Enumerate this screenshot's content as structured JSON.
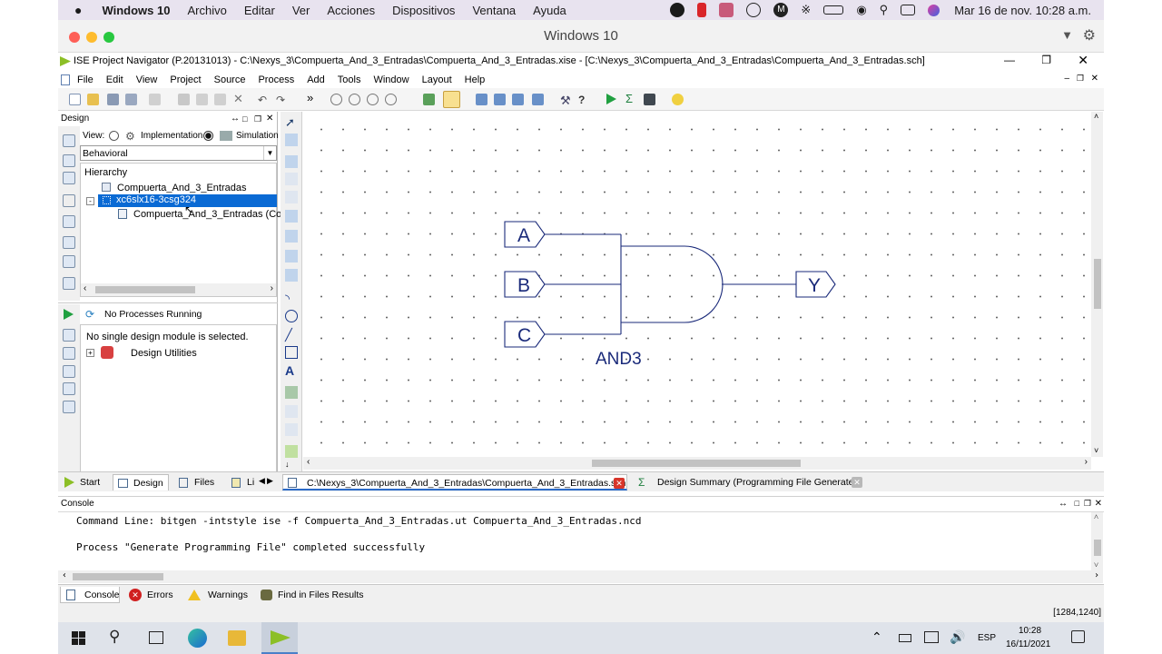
{
  "mac_menubar": {
    "apple": "",
    "app": "Windows 10",
    "items": [
      "Archivo",
      "Editar",
      "Ver",
      "Acciones",
      "Dispositivos",
      "Ventana",
      "Ayuda"
    ],
    "clock": "Mar 16 de nov.  10:28 a.m."
  },
  "vm_window": {
    "title": "Windows 10"
  },
  "ise": {
    "title": "ISE Project Navigator (P.20131013) - C:\\Nexys_3\\Compuerta_And_3_Entradas\\Compuerta_And_3_Entradas.xise - [C:\\Nexys_3\\Compuerta_And_3_Entradas\\Compuerta_And_3_Entradas.sch]",
    "menu": [
      "File",
      "Edit",
      "View",
      "Project",
      "Source",
      "Process",
      "Add",
      "Tools",
      "Window",
      "Layout",
      "Help"
    ],
    "toolbar_more": "»"
  },
  "design_panel": {
    "header": "Design",
    "view_label": "View:",
    "radio_impl": "Implementation",
    "radio_sim": "Simulation",
    "dropdown_value": "Behavioral",
    "hierarchy_label": "Hierarchy",
    "tree": {
      "project": "Compuerta_And_3_Entradas",
      "device": "xc6slx16-3csg324",
      "module": "Compuerta_And_3_Entradas (Cor"
    }
  },
  "processes_panel": {
    "status": "No Processes Running",
    "message": "No single design module is selected.",
    "utilities": "Design Utilities"
  },
  "schematic": {
    "inputs": [
      "A",
      "B",
      "C"
    ],
    "output": "Y",
    "gate_label": "AND3"
  },
  "bottom_tabs": {
    "left": [
      "Start",
      "Design",
      "Files",
      "Li"
    ],
    "doc_tab": "C:\\Nexys_3\\Compuerta_And_3_Entradas\\Compuerta_And_3_Entradas.sch",
    "summary_tab": "Design Summary (Programming File Generated)"
  },
  "console": {
    "header": "Console",
    "lines": [
      "Command Line: bitgen -intstyle ise -f Compuerta_And_3_Entradas.ut Compuerta_And_3_Entradas.ncd",
      "Process \"Generate Programming File\" completed successfully"
    ],
    "tabs": [
      "Console",
      "Errors",
      "Warnings",
      "Find in Files Results"
    ]
  },
  "status": {
    "coords": "[1284,1240]"
  },
  "taskbar": {
    "lang": "ESP",
    "time": "10:28",
    "date": "16/11/2021"
  }
}
